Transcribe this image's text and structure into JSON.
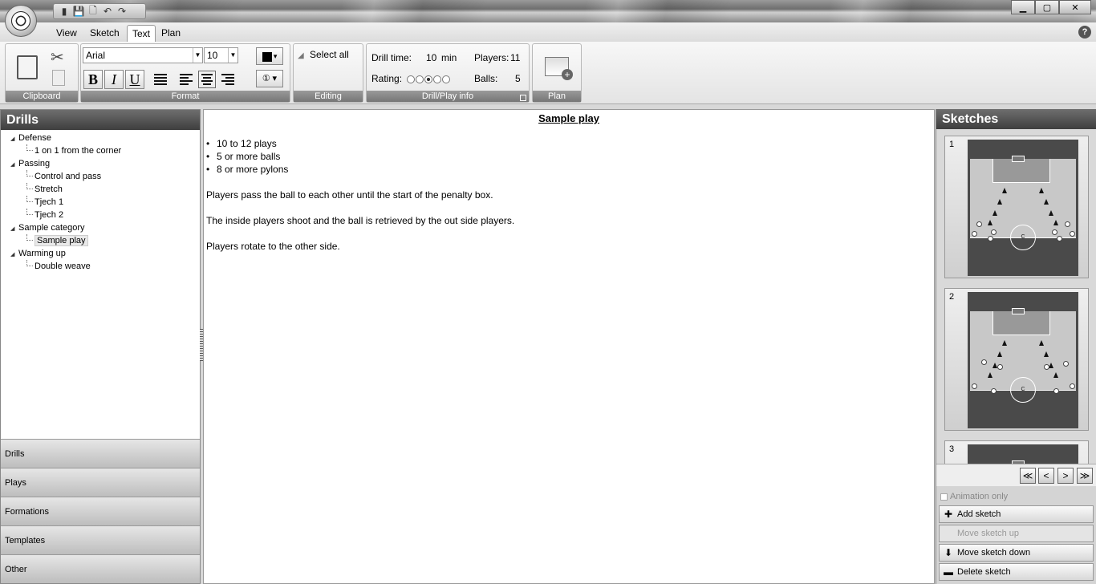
{
  "menubar": {
    "tabs": [
      "View",
      "Sketch",
      "Text",
      "Plan"
    ],
    "active": "Text"
  },
  "ribbon": {
    "clipboard_label": "Clipboard",
    "format_label": "Format",
    "editing_label": "Editing",
    "info_label": "Drill/Play info",
    "plan_label": "Plan",
    "font_family": "Arial",
    "font_size": "10",
    "bold": "B",
    "italic": "I",
    "underline": "U",
    "select_all": "Select all",
    "drill_time_label": "Drill time:",
    "drill_time_value": "10",
    "drill_time_unit": "min",
    "players_label": "Players:",
    "players_value": "11",
    "rating_label": "Rating:",
    "rating_value": 3,
    "rating_max": 5,
    "balls_label": "Balls:",
    "balls_value": "5"
  },
  "left": {
    "title": "Drills",
    "tree": [
      {
        "label": "Defense",
        "children": [
          "1 on 1 from the corner"
        ]
      },
      {
        "label": "Passing",
        "children": [
          "Control and pass",
          "Stretch",
          "Tjech 1",
          "Tjech 2"
        ]
      },
      {
        "label": "Sample category",
        "children": [
          "Sample play"
        ]
      },
      {
        "label": "Warming up",
        "children": [
          "Double weave"
        ]
      }
    ],
    "selected": "Sample play",
    "nav": [
      "Drills",
      "Plays",
      "Formations",
      "Templates",
      "Other"
    ]
  },
  "editor": {
    "title": "Sample play",
    "bullets": [
      "10 to 12 plays",
      "5 or more balls",
      "8 or more pylons"
    ],
    "paragraphs": [
      "Players pass the ball to each other until the start of the penalty box.",
      "The inside players shoot and the ball is retrieved by the out side players.",
      "Players rotate to the other side."
    ]
  },
  "right": {
    "title": "Sketches",
    "sketch_numbers": [
      "1",
      "2",
      "3"
    ],
    "circle_label": "C",
    "pager": [
      "≪",
      "<",
      ">",
      "≫"
    ],
    "animation_only": "Animation only",
    "add_sketch": "Add sketch",
    "move_up": "Move sketch up",
    "move_down": "Move sketch down",
    "delete_sketch": "Delete sketch"
  }
}
